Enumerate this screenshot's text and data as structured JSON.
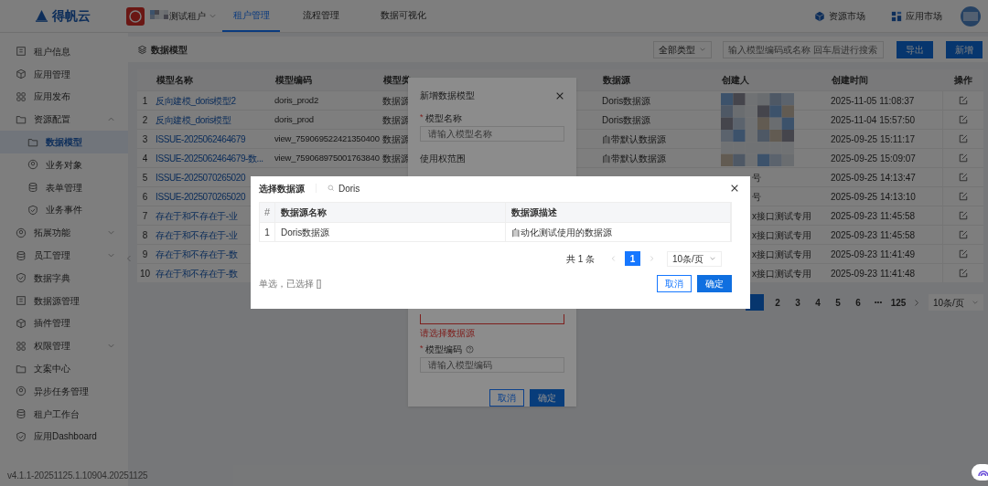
{
  "topbar": {
    "logo": "得帆云",
    "tenant": "测试租户",
    "tabs": [
      {
        "label": "租户管理",
        "selected": true
      },
      {
        "label": "流程管理",
        "selected": false
      },
      {
        "label": "数据可视化",
        "selected": false
      }
    ],
    "links": [
      "资源市场",
      "应用市场"
    ]
  },
  "sidebar": {
    "items": [
      {
        "label": "租户信息"
      },
      {
        "label": "应用管理"
      },
      {
        "label": "应用发布"
      },
      {
        "label": "资源配置",
        "expanded": true,
        "children": [
          {
            "label": "数据模型",
            "selected": true
          },
          {
            "label": "业务对象",
            "selected": false
          },
          {
            "label": "表单管理",
            "selected": false
          },
          {
            "label": "业务事件",
            "selected": false
          }
        ]
      },
      {
        "label": "拓展功能",
        "expanded": false
      },
      {
        "label": "员工管理",
        "expanded": false
      },
      {
        "label": "数据字典"
      },
      {
        "label": "数据源管理"
      },
      {
        "label": "插件管理"
      },
      {
        "label": "权限管理",
        "expanded": false
      },
      {
        "label": "文案中心"
      },
      {
        "label": "异步任务管理"
      },
      {
        "label": "租户工作台"
      },
      {
        "label": "应用Dashboard"
      }
    ],
    "version": "v4.1.1-20251125.1.10904.20251125"
  },
  "page": {
    "title": "数据模型",
    "type_filter": "全部类型",
    "search": {
      "placeholder": "输入模型编码或名称 回车后进行搜索"
    },
    "buttons": [
      {
        "label": "导出",
        "kind": "primary"
      },
      {
        "label": "新增",
        "kind": "primary"
      }
    ]
  },
  "table": {
    "columns": [
      "模型名称",
      "模型编码",
      "模型类",
      "数据源",
      "创建人",
      "创建时间",
      "操作"
    ],
    "rows": [
      {
        "index": "1",
        "name": "反向建模_doris模型2",
        "code": "doris_prod2",
        "type": "数据源",
        "source": "Doris数据源",
        "time": "2025-11-05 11:08:37"
      },
      {
        "index": "2",
        "name": "反向建模_doris模型",
        "code": "doris_prod",
        "type": "数据源",
        "source": "Doris数据源",
        "time": "2025-11-04 15:57:50"
      },
      {
        "index": "3",
        "name": "ISSUE-2025062464679",
        "code": "view_759069522421350400",
        "type": "数据源",
        "source": "自带默认数据源",
        "time": "2025-09-25 15:11:17"
      },
      {
        "index": "4",
        "name": "ISSUE-2025062464679-数...",
        "code": "view_759068975001763840",
        "type": "数据源",
        "source": "自带默认数据源",
        "time": "2025-09-25 15:09:07"
      },
      {
        "index": "5",
        "name": "ISSUE-2025070265020",
        "creator": "号",
        "time": "2025-09-25 14:13:47"
      },
      {
        "index": "6",
        "name": "ISSUE-2025070265020",
        "creator": "号",
        "time": "2025-09-25 14:13:10"
      },
      {
        "index": "7",
        "name": "存在于和不存在于-业",
        "creator": "x接口测试专用",
        "time": "2025-09-23 11:45:58"
      },
      {
        "index": "8",
        "name": "存在于和不存在于-业",
        "creator": "x接口测试专用",
        "time": "2025-09-23 11:45:58"
      },
      {
        "index": "9",
        "name": "存在于和不存在于-数",
        "creator": "x接口测试专用",
        "time": "2025-09-23 11:41:49"
      },
      {
        "index": "10",
        "name": "存在于和不存在于-数",
        "creator": "x接口测试专用",
        "time": "2025-09-23 11:41:48"
      }
    ]
  },
  "pagination": {
    "pages": [
      {
        "label": "2",
        "kind": "page"
      },
      {
        "label": "3",
        "kind": "page"
      },
      {
        "label": "4",
        "kind": "page"
      },
      {
        "label": "5",
        "kind": "page"
      },
      {
        "label": "6",
        "kind": "page"
      },
      {
        "label": "•••",
        "kind": "more"
      },
      {
        "label": "125",
        "kind": "page"
      }
    ],
    "page_size": "10条/页"
  },
  "create_dialog": {
    "title": "新增数据模型",
    "name_field": {
      "mark": "*",
      "label": "模型名称",
      "placeholder": "请输入模型名称"
    },
    "scope_label": "使用权范围",
    "source_error": "请选择数据源",
    "code_field": {
      "mark": "*",
      "label": "模型编码",
      "placeholder": "请输入模型编码"
    },
    "buttons": [
      {
        "label": "取消",
        "kind": "default"
      },
      {
        "label": "确定",
        "kind": "primary"
      }
    ]
  },
  "source_dialog": {
    "title": "选择数据源",
    "search_value": "Doris",
    "columns": [
      "#",
      "数据源名称",
      "数据源描述"
    ],
    "rows": [
      {
        "index": "1",
        "name": "Doris数据源",
        "description": "自动化测试使用的数据源"
      }
    ],
    "pagination": {
      "total": "共 1 条",
      "pages": [
        {
          "label": "1",
          "selected": true
        }
      ],
      "page_size": "10条/页"
    },
    "note": "单选，已选择 []",
    "buttons": [
      {
        "label": "取消",
        "kind": "default"
      },
      {
        "label": "确定",
        "kind": "primary"
      }
    ]
  }
}
